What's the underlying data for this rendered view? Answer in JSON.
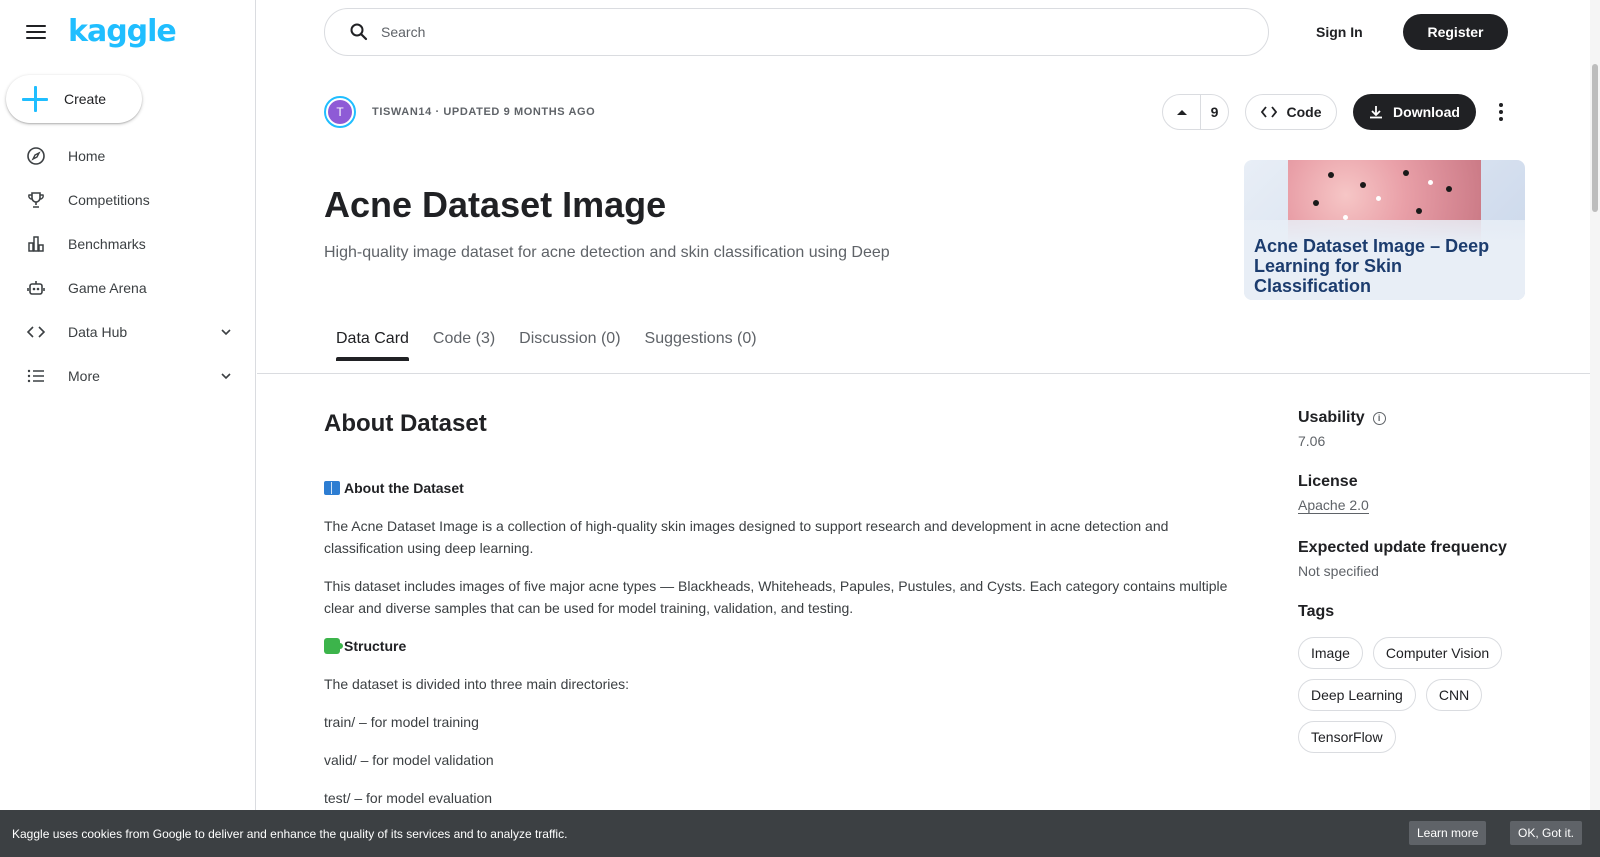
{
  "brand": {
    "logo": "kaggle"
  },
  "sidebar": {
    "create_label": "Create",
    "items": [
      {
        "label": "Home",
        "icon": "compass-icon"
      },
      {
        "label": "Competitions",
        "icon": "trophy-icon"
      },
      {
        "label": "Benchmarks",
        "icon": "bar-chart-icon"
      },
      {
        "label": "Game Arena",
        "icon": "robot-icon"
      },
      {
        "label": "Data Hub",
        "icon": "code-brackets-icon"
      },
      {
        "label": "More",
        "icon": "list-icon"
      }
    ]
  },
  "header": {
    "search_placeholder": "Search",
    "signin_label": "Sign In",
    "register_label": "Register"
  },
  "dataset": {
    "avatar_initial": "T",
    "author_line": "TISWAN14 · UPDATED 9 MONTHS AGO",
    "upvotes": "9",
    "code_label": "Code",
    "download_label": "Download",
    "title": "Acne Dataset Image",
    "subtitle": "High-quality image dataset for acne detection and skin classification using Deep",
    "thumbnail_text": "Acne Dataset Image – Deep Learning for Skin Classification"
  },
  "tabs": [
    {
      "label": "Data Card",
      "active": true
    },
    {
      "label": "Code (3)",
      "active": false
    },
    {
      "label": "Discussion (0)",
      "active": false
    },
    {
      "label": "Suggestions (0)",
      "active": false
    }
  ],
  "content": {
    "about_title": "About Dataset",
    "about_heading": "About the Dataset",
    "para1": "The Acne Dataset Image is a collection of high-quality skin images designed to support research and development in acne detection and classification using deep learning.",
    "para2": "This dataset includes images of five major acne types — Blackheads, Whiteheads, Papules, Pustules, and Cysts. Each category contains multiple clear and diverse samples that can be used for model training, validation, and testing.",
    "structure_heading": "Structure",
    "para3": "The dataset is divided into three main directories:",
    "dir_train": "train/ – for model training",
    "dir_valid": "valid/ – for model validation",
    "dir_test": "test/ – for model evaluation"
  },
  "meta": {
    "usability_label": "Usability",
    "usability_value": "7.06",
    "license_label": "License",
    "license_value": "Apache 2.0",
    "frequency_label": "Expected update frequency",
    "frequency_value": "Not specified",
    "tags_label": "Tags",
    "tags": [
      "Image",
      "Computer Vision",
      "Deep Learning",
      "CNN",
      "TensorFlow"
    ]
  },
  "cookie": {
    "text": "Kaggle uses cookies from Google to deliver and enhance the quality of its services and to analyze traffic.",
    "learn_more": "Learn more",
    "ok": "OK, Got it."
  },
  "colors": {
    "brand": "#20beff",
    "dark_button": "#202124",
    "cookie_bg": "#3c4043"
  }
}
